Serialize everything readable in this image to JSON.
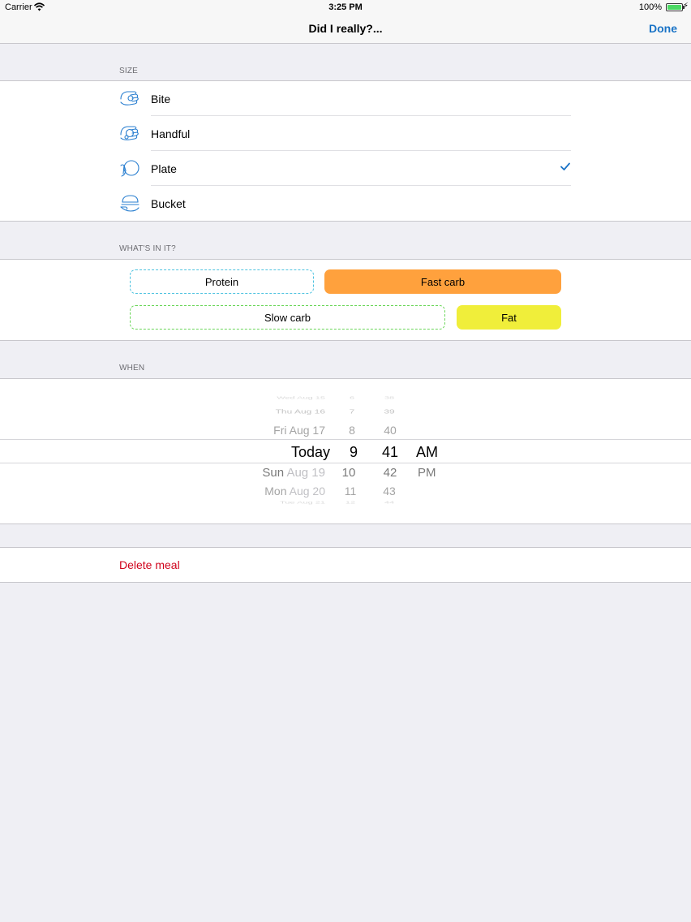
{
  "status_bar": {
    "carrier": "Carrier",
    "time": "3:25 PM",
    "battery_percent": "100%",
    "battery_level": 1.0
  },
  "nav": {
    "title": "Did I really?...",
    "done_label": "Done"
  },
  "size": {
    "header": "SIZE",
    "items": [
      {
        "label": "Bite",
        "icon": "bite-hand-icon",
        "selected": false
      },
      {
        "label": "Handful",
        "icon": "handful-hand-icon",
        "selected": false
      },
      {
        "label": "Plate",
        "icon": "plate-hand-icon",
        "selected": true
      },
      {
        "label": "Bucket",
        "icon": "bucket-hand-icon",
        "selected": false
      }
    ]
  },
  "contents": {
    "header": "WHAT'S IN IT?",
    "protein": "Protein",
    "fast_carb": "Fast carb",
    "slow_carb": "Slow carb",
    "fat": "Fat"
  },
  "when": {
    "header": "WHEN",
    "dates": [
      {
        "dow": "Wed",
        "date": "Aug 15"
      },
      {
        "dow": "Thu",
        "date": "Aug 16"
      },
      {
        "dow": "Fri",
        "date": "Aug 17"
      },
      {
        "dow": "Today",
        "date": ""
      },
      {
        "dow": "Sun",
        "date": "Aug 19"
      },
      {
        "dow": "Mon",
        "date": "Aug 20"
      },
      {
        "dow": "Tue",
        "date": "Aug 21"
      }
    ],
    "hours": [
      "6",
      "7",
      "8",
      "9",
      "10",
      "11",
      "12"
    ],
    "minutes": [
      "38",
      "39",
      "40",
      "41",
      "42",
      "43",
      "44"
    ],
    "ampm": [
      "AM",
      "PM"
    ],
    "selected": {
      "date": "Today",
      "hour": "9",
      "minute": "41",
      "ampm": "AM"
    }
  },
  "delete_label": "Delete meal",
  "colors": {
    "accent": "#1a73c6",
    "destructive": "#d0021b",
    "protein_border": "#4fc3e0",
    "fast_carb_fill": "#ffa13d",
    "slow_carb_border": "#6bd65a",
    "fat_fill": "#f0ee3a",
    "background": "#efeff4"
  }
}
